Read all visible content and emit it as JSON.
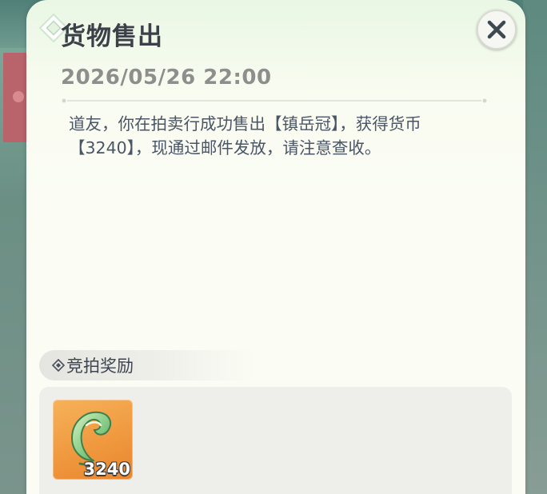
{
  "mail": {
    "title": "货物售出",
    "date": "2026/05/26 22:00",
    "message": "道友，你在拍卖行成功售出【镇岳冠】，获得货币\n【3240】，现通过邮件发放，请注意查收。"
  },
  "rewards": {
    "section_label": "竞拍奖励",
    "items": [
      {
        "icon": "jade-hook-icon",
        "count": "3240"
      }
    ]
  },
  "icons": {
    "close": "close-icon",
    "section": "diamond-icon",
    "corner": "corner-ornament-icon"
  },
  "colors": {
    "panel_bg": "#fbfdf5",
    "title": "#3c4048",
    "date": "#8d8f8d",
    "message": "#4a5566",
    "item_bg": "#f0993f"
  }
}
